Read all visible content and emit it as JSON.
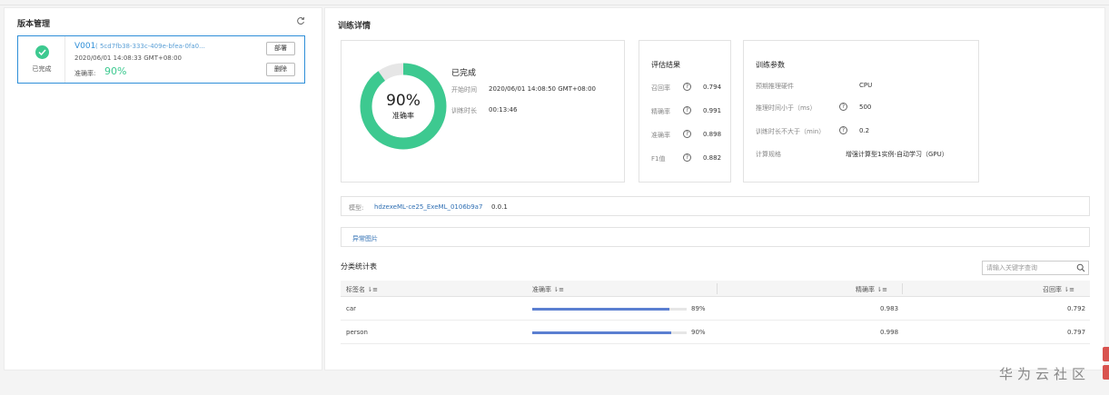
{
  "left": {
    "title": "版本管理",
    "version": {
      "name": "V001",
      "id": "( 5cd7fb38-333c-409e-bfea-0fa0...",
      "time": "2020/06/01 14:08:33 GMT+08:00",
      "status": "已完成",
      "accuracy_label": "准确率:",
      "accuracy_value": "90%",
      "deploy_label": "部署",
      "delete_label": "删除"
    }
  },
  "detail": {
    "title": "训练详情",
    "summary": {
      "donut_percent": "90%",
      "donut_fraction": 0.9,
      "donut_label": "准确率",
      "status": "已完成",
      "start_label": "开始时间",
      "start_value": "2020/06/01 14:08:50 GMT+08:00",
      "duration_label": "训练时长",
      "duration_value": "00:13:46"
    },
    "eval": {
      "title": "评估结果",
      "rows": [
        {
          "label": "召回率",
          "value": "0.794"
        },
        {
          "label": "精确率",
          "value": "0.991"
        },
        {
          "label": "准确率",
          "value": "0.898"
        },
        {
          "label": "F1值",
          "value": "0.882"
        }
      ]
    },
    "params": {
      "title": "训练参数",
      "rows": [
        {
          "label": "预期推理硬件",
          "value": "CPU"
        },
        {
          "label": "推理时间小于（ms）",
          "value": "500"
        },
        {
          "label": "训练时长不大于（min）",
          "value": "0.2"
        },
        {
          "label": "计算规格",
          "value": "增强计算型1实例-自动学习（GPU）"
        }
      ]
    },
    "model": {
      "label": "模型:",
      "link": "hdzexeML-ce25_ExeML_0106b9a7",
      "version": "0.0.1"
    },
    "abnormal_link": "异常图片",
    "stats": {
      "title": "分类统计表",
      "search_placeholder": "请输入关键字查询",
      "columns": [
        "标签名",
        "准确率",
        "精确率",
        "召回率"
      ],
      "rows": [
        {
          "label": "car",
          "accuracy": "89%",
          "accuracy_fraction": 0.89,
          "precision": "0.983",
          "recall": "0.792"
        },
        {
          "label": "person",
          "accuracy": "90%",
          "accuracy_fraction": 0.9,
          "precision": "0.998",
          "recall": "0.797"
        }
      ]
    }
  },
  "colors": {
    "accent_green": "#3dc990",
    "link_blue": "#2f8fd8",
    "bar_blue": "#5b7fd1"
  },
  "watermark": "华为云社区"
}
